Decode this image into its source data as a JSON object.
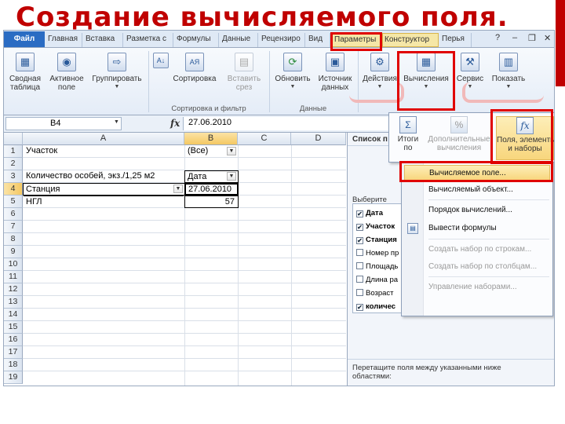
{
  "slide": {
    "title": "Создание вычисляемого поля."
  },
  "colors": {
    "title": "#c00000",
    "highlight": "#e00000",
    "menu_highlight": "#f8d67d",
    "file_tab": "#2a6cc3",
    "tool_tab": "#f5e7a7"
  },
  "tabs": [
    "Файл",
    "Главная",
    "Вставка",
    "Разметка с",
    "Формулы",
    "Данные",
    "Рецензиро",
    "Вид",
    "Параметры",
    "Конструктор",
    "Перья"
  ],
  "window_controls": {
    "help": "?",
    "minimize": "–",
    "restore": "❐",
    "close": "✕"
  },
  "ribbon": {
    "buttons": [
      {
        "label1": "Сводная",
        "label2": "таблица",
        "icon": "pivot-table-icon",
        "glyph": "▦"
      },
      {
        "label1": "Активное",
        "label2": "поле",
        "icon": "active-field-icon",
        "glyph": "◉"
      },
      {
        "label1": "Группировать",
        "label2": "",
        "icon": "group-icon",
        "glyph": "⇨"
      },
      {
        "label1": "",
        "label2": "",
        "icon": "sort-az-icon",
        "glyph": "А↓"
      },
      {
        "label1": "Сортировка",
        "label2": "",
        "icon": "sort-icon",
        "glyph": "АЯ"
      },
      {
        "label1": "Вставить",
        "label2": "срез",
        "icon": "slicer-icon",
        "glyph": "▤"
      },
      {
        "label1": "Обновить",
        "label2": "",
        "icon": "refresh-icon",
        "glyph": "⟳"
      },
      {
        "label1": "Источник",
        "label2": "данных",
        "icon": "data-source-icon",
        "glyph": "▣"
      },
      {
        "label1": "Действия",
        "label2": "",
        "icon": "actions-icon",
        "glyph": "⚙"
      },
      {
        "label1": "Вычисления",
        "label2": "",
        "icon": "calculations-icon",
        "glyph": "▦"
      },
      {
        "label1": "Сервис",
        "label2": "",
        "icon": "tools-icon",
        "glyph": "⚒"
      },
      {
        "label1": "Показать",
        "label2": "",
        "icon": "show-icon",
        "glyph": "▥"
      }
    ],
    "groups": {
      "sort_filter": "Сортировка и фильтр",
      "data": "Данные"
    }
  },
  "formula_bar": {
    "name_box": "B4",
    "fx": "fx",
    "value": "27.06.2010"
  },
  "columns": [
    "A",
    "B",
    "C",
    "D"
  ],
  "rows": [
    "1",
    "2",
    "3",
    "4",
    "5",
    "6",
    "7",
    "8",
    "9",
    "10",
    "11",
    "12",
    "13",
    "14",
    "15",
    "16",
    "17",
    "18",
    "19"
  ],
  "cells": {
    "a1": "Участок",
    "b1": "(Все)",
    "a3": "Количество особей, экз./1,25 м2",
    "b3": "Дата",
    "a4": "Станция",
    "b4": "27.06.2010",
    "a5": "НГЛ",
    "b5": "57"
  },
  "field_pane": {
    "title": "Список п",
    "subtitle": "Выберите",
    "fields": [
      {
        "label": "Дата",
        "checked": "✔",
        "bold": true
      },
      {
        "label": "Участок",
        "checked": "✔",
        "bold": true
      },
      {
        "label": "Станция",
        "checked": "✔",
        "bold": true
      },
      {
        "label": "Номер пр",
        "checked": "",
        "bold": false
      },
      {
        "label": "Площадь",
        "checked": "",
        "bold": false
      },
      {
        "label": "Длина ра",
        "checked": "",
        "bold": false
      },
      {
        "label": "Возраст",
        "checked": "",
        "bold": false
      },
      {
        "label": "количес",
        "checked": "✔",
        "bold": true
      }
    ],
    "footer_line1": "Перетащите поля между указанными ниже",
    "footer_line2": "областями:"
  },
  "calc_menu": {
    "totals_label1": "Итоги",
    "totals_label2": "по",
    "extra_label1": "Дополнительные",
    "extra_label2": "вычисления",
    "fields_label1": "Поля, элементы",
    "fields_label2": "и наборы"
  },
  "fields_menu": {
    "items": [
      {
        "label": "Вычисляемое поле...",
        "state": "highlighted"
      },
      {
        "label": "Вычисляемый объект...",
        "state": "enabled"
      },
      {
        "label": "Порядок вычислений...",
        "state": "enabled"
      },
      {
        "label": "Вывести формулы",
        "state": "enabled"
      },
      {
        "label": "Создать набор по строкам...",
        "state": "disabled"
      },
      {
        "label": "Создать набор по столбцам...",
        "state": "disabled"
      },
      {
        "label": "Управление наборами...",
        "state": "disabled"
      }
    ]
  }
}
